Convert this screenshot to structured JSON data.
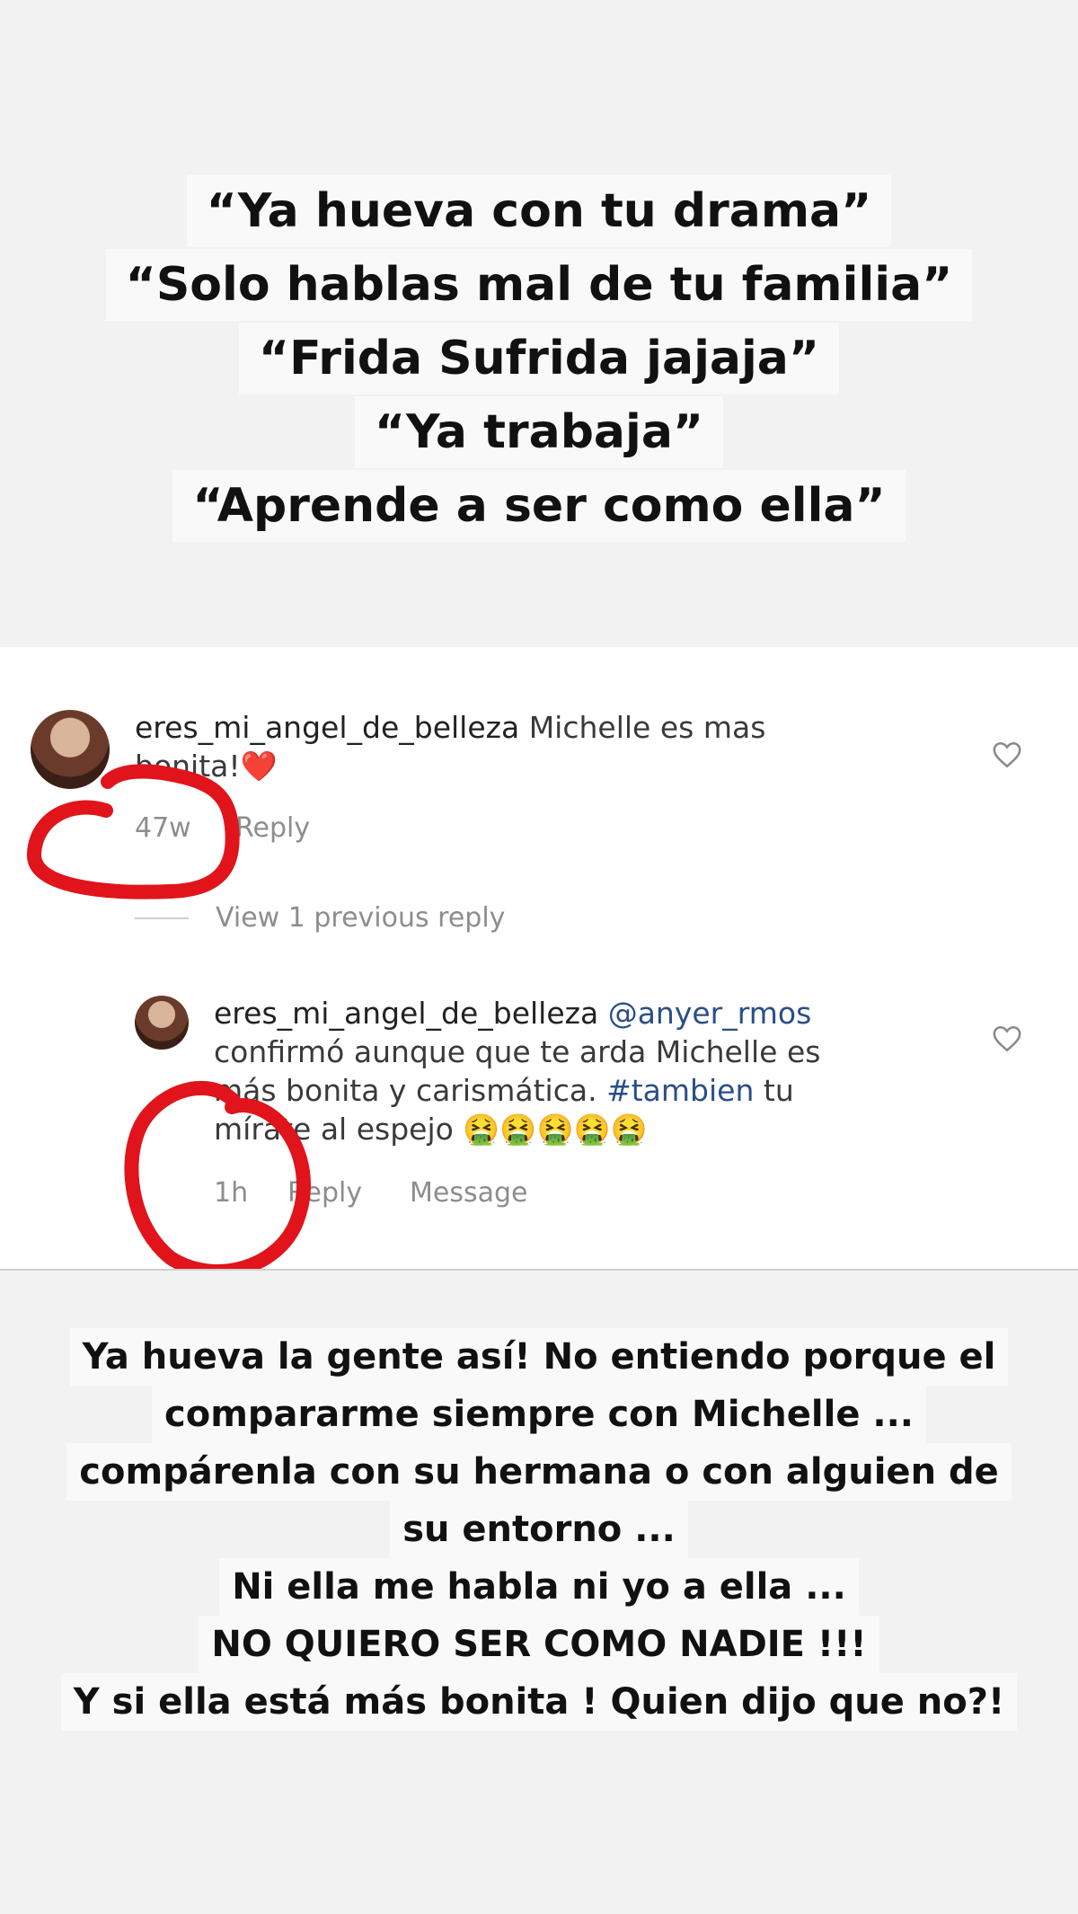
{
  "top_quotes": [
    "“Ya hueva con tu drama”",
    "“Solo hablas mal de tu familia”",
    "“Frida Sufrida jajaja”",
    "“Ya trabaja”",
    "“Aprende a ser como ella”"
  ],
  "comment1": {
    "username": "eres_mi_angel_de_belleza",
    "text_line1": "Michelle es mas",
    "text_line2": "bonita!❤️",
    "time": "47w",
    "reply_label": "Reply"
  },
  "view_previous": "View 1 previous reply",
  "comment2": {
    "username": "eres_mi_angel_de_belleza",
    "mention": "@anyer_rmos",
    "line2": "confirmó aunque que te arda Michelle es",
    "line3_prefix": "más bonita y carismática.",
    "hashtag": "#tambien",
    "line3_suffix": "tu",
    "line4": "mírate al espejo",
    "emojis": "🤮🤮🤮🤮🤮",
    "time": "1h",
    "reply_label": "Reply",
    "message_label": "Message"
  },
  "bottom_lines": [
    "Ya hueva la gente así! No entiendo porque el",
    "compararme siempre con Michelle ...",
    "compárenla con su hermana o con alguien de",
    "su entorno ...",
    "Ni ella me habla ni yo a ella ...",
    "NO QUIERO SER COMO NADIE !!!",
    "Y si ella está más bonita ! Quien dijo que no?!"
  ],
  "colors": {
    "background": "#f2f2f2",
    "red_mark": "#e0141a",
    "hashtag": "#2a4f86"
  },
  "icons": [
    "heart-icon",
    "heart-icon"
  ]
}
